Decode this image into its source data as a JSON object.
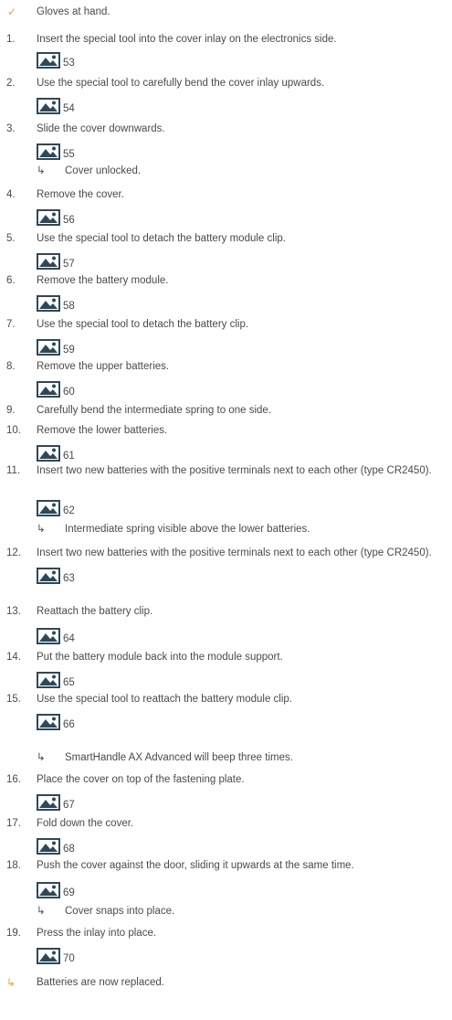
{
  "steps": [
    {
      "type": "check",
      "marker": "✓",
      "text": "Gloves at hand."
    },
    {
      "type": "step",
      "marker": "1.",
      "text": "Insert the special tool into the cover inlay on the electronics side."
    },
    {
      "type": "image",
      "fig": "53"
    },
    {
      "type": "step",
      "marker": "2.",
      "text": "Use the special tool to carefully bend the cover inlay upwards."
    },
    {
      "type": "image",
      "fig": "54"
    },
    {
      "type": "step",
      "marker": "3.",
      "text": "Slide the cover downwards."
    },
    {
      "type": "image",
      "fig": "55"
    },
    {
      "type": "sub",
      "marker": "↳",
      "text": "Cover unlocked."
    },
    {
      "type": "step",
      "marker": "4.",
      "text": "Remove the cover."
    },
    {
      "type": "image",
      "fig": "56"
    },
    {
      "type": "step",
      "marker": "5.",
      "text": "Use the special tool to detach the battery module clip."
    },
    {
      "type": "image",
      "fig": "57"
    },
    {
      "type": "step",
      "marker": "6.",
      "text": "Remove the battery module."
    },
    {
      "type": "image",
      "fig": "58"
    },
    {
      "type": "step",
      "marker": "7.",
      "text": "Use the special tool to detach the battery clip."
    },
    {
      "type": "image",
      "fig": "59"
    },
    {
      "type": "step",
      "marker": "8.",
      "text": "Remove the upper batteries."
    },
    {
      "type": "image",
      "fig": "60"
    },
    {
      "type": "step",
      "marker": "9.",
      "text": "Carefully bend the intermediate spring to one side."
    },
    {
      "type": "step",
      "marker": "10.",
      "text": "Remove the lower batteries."
    },
    {
      "type": "image",
      "fig": "61"
    },
    {
      "type": "step",
      "marker": "11.",
      "text": "Insert two new batteries with the positive terminals next to each other (type CR2450)."
    },
    {
      "type": "image",
      "fig": "62"
    },
    {
      "type": "sub",
      "marker": "↳",
      "text": "Intermediate spring visible above the lower batteries."
    },
    {
      "type": "step",
      "marker": "12.",
      "text": "Insert two new batteries with the positive terminals next to each other (type CR2450)."
    },
    {
      "type": "image",
      "fig": "63"
    },
    {
      "type": "step",
      "marker": "13.",
      "text": "Reattach the battery clip."
    },
    {
      "type": "image",
      "fig": "64"
    },
    {
      "type": "step",
      "marker": "14.",
      "text": "Put the battery module back into the module support."
    },
    {
      "type": "image",
      "fig": "65"
    },
    {
      "type": "step",
      "marker": "15.",
      "text": "Use the special tool to reattach the battery module clip."
    },
    {
      "type": "image",
      "fig": "66"
    },
    {
      "type": "sub",
      "marker": "↳",
      "text": "SmartHandle AX Advanced will beep three times."
    },
    {
      "type": "step",
      "marker": "16.",
      "text": "Place the cover on top of the fastening plate."
    },
    {
      "type": "image",
      "fig": "67"
    },
    {
      "type": "step",
      "marker": "17.",
      "text": "Fold down the cover."
    },
    {
      "type": "image",
      "fig": "68"
    },
    {
      "type": "step",
      "marker": "18.",
      "text": "Push the cover against the door, sliding it upwards at the same time."
    },
    {
      "type": "image",
      "fig": "69"
    },
    {
      "type": "sub",
      "marker": "↳",
      "text": "Cover snaps into place."
    },
    {
      "type": "step",
      "marker": "19.",
      "text": "Press the inlay into place."
    },
    {
      "type": "image",
      "fig": "70"
    },
    {
      "type": "result",
      "marker": "↳",
      "text": "Batteries are now replaced."
    }
  ],
  "colors": {
    "text": "#4a4a4a",
    "accent": "#e8a03c",
    "icon": "#2f4858"
  },
  "icons": {
    "image_placeholder": "image-placeholder-icon"
  }
}
